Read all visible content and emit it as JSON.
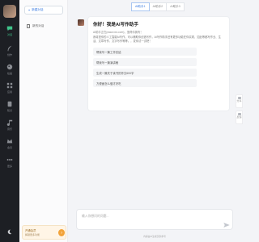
{
  "nav": {
    "items": [
      {
        "label": "对话",
        "icon": "chat-bubble-icon",
        "active": true
      },
      {
        "label": "创作",
        "icon": "feather-pen-icon"
      },
      {
        "label": "绘画",
        "icon": "palette-icon"
      },
      {
        "label": "应用",
        "icon": "apps-grid-icon"
      },
      {
        "label": "知识",
        "icon": "book-icon"
      },
      {
        "label": "音乐",
        "icon": "music-note-icon"
      },
      {
        "label": "会员",
        "icon": "crown-icon"
      },
      {
        "label": "更多",
        "icon": "grid-more-icon"
      }
    ],
    "bottom_icon": "moon-icon"
  },
  "sidebar": {
    "new_chat_label": "新建对话",
    "history_item": "新的对话",
    "login": {
      "line1": "开通会员",
      "line2": "解锁更多功能",
      "badge": "?"
    }
  },
  "tabs": [
    "AI助手1",
    "AI助手2",
    "AI助手3"
  ],
  "chat": {
    "title": "你好！我是AI写作助手",
    "url": "AI助手正在(www.xxx.com)，值得你拥有！",
    "desc": "我将是你的人工智能AI写作，可以辅助你创造写作，AI写作助手还有更多功能在你实现，如此等都写作业、生活、文章写作、文字写作等等。，发你试一试吧！",
    "suggestions": [
      "帮我写一篇工作总结",
      "帮我写一篇演讲稿",
      "生成一篇关于读书的作文600字",
      "方便面怎么做才好吃"
    ]
  },
  "right_tools": [
    {
      "label": "分享",
      "icon": "share-icon"
    },
    {
      "label": "反馈",
      "icon": "feedback-icon"
    }
  ],
  "input": {
    "placeholder": "输入你想问的问题...",
    "send_icon": "send-icon"
  },
  "footer": "内容由AI生成仅供参考",
  "colors": {
    "accent": "#3a7be0",
    "nav_bg": "#1d1f24",
    "active_nav": "#3fc38a"
  }
}
